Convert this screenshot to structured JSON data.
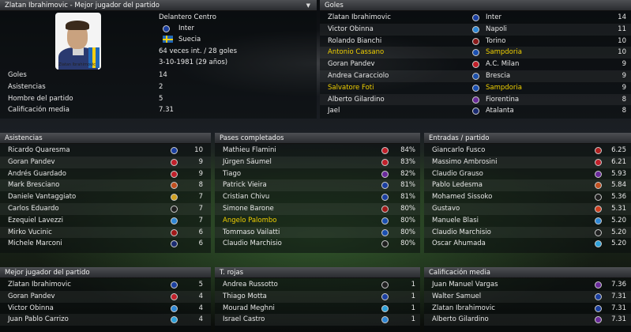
{
  "player_panel": {
    "title": "Zlatan Ibrahimovic - Mejor jugador del partido",
    "position": "Delantero Centro",
    "club": "Inter",
    "nation": "Suecia",
    "caps": "64 veces int. / 28 goles",
    "birth": "3-10-1981 (29 años)",
    "photo_caption": "Zlatan Ibrahimovic",
    "stats": [
      {
        "label": "Goles",
        "value": "14"
      },
      {
        "label": "Asistencias",
        "value": "2"
      },
      {
        "label": "Hombre del partido",
        "value": "5"
      },
      {
        "label": "Calificación media",
        "value": "7.31"
      }
    ]
  },
  "goles": {
    "title": "Goles",
    "rows": [
      {
        "name": "Zlatan Ibrahimovic",
        "club": "Inter",
        "value": "14",
        "badge": "#1b3fa0",
        "hl": false
      },
      {
        "name": "Victor Obinna",
        "club": "Napoli",
        "value": "11",
        "badge": "#2e86d4",
        "hl": false
      },
      {
        "name": "Rolando Bianchi",
        "club": "Torino",
        "value": "10",
        "badge": "#8b1a1a",
        "hl": false
      },
      {
        "name": "Antonio Cassano",
        "club": "Sampdoria",
        "value": "10",
        "badge": "#1a4fb0",
        "hl": true
      },
      {
        "name": "Goran Pandev",
        "club": "A.C. Milan",
        "value": "9",
        "badge": "#c0202a",
        "hl": false
      },
      {
        "name": "Andrea Caracciolo",
        "club": "Brescia",
        "value": "9",
        "badge": "#1c4fa8",
        "hl": false
      },
      {
        "name": "Salvatore Foti",
        "club": "Sampdoria",
        "value": "9",
        "badge": "#1a4fb0",
        "hl": true
      },
      {
        "name": "Alberto Gilardino",
        "club": "Fiorentina",
        "value": "8",
        "badge": "#6a2a9a",
        "hl": false
      },
      {
        "name": "Jael",
        "club": "Atalanta",
        "value": "8",
        "badge": "#1a2a70",
        "hl": false
      }
    ]
  },
  "asistencias": {
    "title": "Asistencias",
    "rows": [
      {
        "name": "Ricardo Quaresma",
        "value": "10",
        "badge": "#1b3fa0",
        "hl": false
      },
      {
        "name": "Goran Pandev",
        "value": "9",
        "badge": "#c0202a",
        "hl": false
      },
      {
        "name": "Andrés Guardado",
        "value": "9",
        "badge": "#c0202a",
        "hl": false
      },
      {
        "name": "Mark Bresciano",
        "value": "8",
        "badge": "#c05020",
        "hl": false
      },
      {
        "name": "Daniele Vantaggiato",
        "value": "7",
        "badge": "#d0a020",
        "hl": false
      },
      {
        "name": "Carlos Eduardo",
        "value": "7",
        "badge": "#202020",
        "hl": false
      },
      {
        "name": "Ezequiel Lavezzi",
        "value": "7",
        "badge": "#2e86d4",
        "hl": false
      },
      {
        "name": "Mirko Vucinic",
        "value": "6",
        "badge": "#a01818",
        "hl": false
      },
      {
        "name": "Michele Marconi",
        "value": "6",
        "badge": "#1a2a70",
        "hl": false
      }
    ]
  },
  "pases": {
    "title": "Pases completados",
    "rows": [
      {
        "name": "Mathieu Flamini",
        "value": "84%",
        "badge": "#c0202a",
        "hl": false
      },
      {
        "name": "Jürgen Säumel",
        "value": "83%",
        "badge": "#c0202a",
        "hl": false
      },
      {
        "name": "Tiago",
        "value": "82%",
        "badge": "#6a2a9a",
        "hl": false
      },
      {
        "name": "Patrick Vieira",
        "value": "81%",
        "badge": "#1b3fa0",
        "hl": false
      },
      {
        "name": "Cristian Chivu",
        "value": "81%",
        "badge": "#1b3fa0",
        "hl": false
      },
      {
        "name": "Simone Barone",
        "value": "80%",
        "badge": "#a01818",
        "hl": false
      },
      {
        "name": "Angelo Palombo",
        "value": "80%",
        "badge": "#1a4fb0",
        "hl": true
      },
      {
        "name": "Tommaso Vailatti",
        "value": "80%",
        "badge": "#1a4fb0",
        "hl": false
      },
      {
        "name": "Claudio Marchisio",
        "value": "80%",
        "badge": "#202020",
        "hl": false
      }
    ]
  },
  "entradas": {
    "title": "Entradas / partido",
    "rows": [
      {
        "name": "Giancarlo Fusco",
        "value": "6.25",
        "badge": "#b02020",
        "hl": false
      },
      {
        "name": "Massimo Ambrosini",
        "value": "6.21",
        "badge": "#c0202a",
        "hl": false
      },
      {
        "name": "Claudio Grauso",
        "value": "5.93",
        "badge": "#6a2a9a",
        "hl": false
      },
      {
        "name": "Pablo Ledesma",
        "value": "5.84",
        "badge": "#c05020",
        "hl": false
      },
      {
        "name": "Mohamed Sissoko",
        "value": "5.36",
        "badge": "#202020",
        "hl": false
      },
      {
        "name": "Gustavo",
        "value": "5.31",
        "badge": "#d04020",
        "hl": false
      },
      {
        "name": "Manuele Blasi",
        "value": "5.20",
        "badge": "#2e86d4",
        "hl": false
      },
      {
        "name": "Claudio Marchisio",
        "value": "5.20",
        "badge": "#202020",
        "hl": false
      },
      {
        "name": "Oscar Ahumada",
        "value": "5.20",
        "badge": "#2ea0d8",
        "hl": false
      }
    ]
  },
  "mejor": {
    "title": "Mejor jugador del partido",
    "rows": [
      {
        "name": "Zlatan Ibrahimovic",
        "value": "5",
        "badge": "#1b3fa0",
        "hl": false
      },
      {
        "name": "Goran Pandev",
        "value": "4",
        "badge": "#c0202a",
        "hl": false
      },
      {
        "name": "Victor Obinna",
        "value": "4",
        "badge": "#2e86d4",
        "hl": false
      },
      {
        "name": "Juan Pablo Carrizo",
        "value": "4",
        "badge": "#2ea0d8",
        "hl": false
      }
    ]
  },
  "rojas": {
    "title": "T. rojas",
    "rows": [
      {
        "name": "Andrea Russotto",
        "value": "1",
        "badge": "#202020",
        "hl": false
      },
      {
        "name": "Thiago Motta",
        "value": "1",
        "badge": "#1b3fa0",
        "hl": false
      },
      {
        "name": "Mourad Meghni",
        "value": "1",
        "badge": "#2ea0d8",
        "hl": false
      },
      {
        "name": "Israel Castro",
        "value": "1",
        "badge": "#2e86d4",
        "hl": false
      }
    ]
  },
  "calificacion": {
    "title": "Calificación media",
    "rows": [
      {
        "name": "Juan Manuel Vargas",
        "value": "7.36",
        "badge": "#6a2a9a",
        "hl": false
      },
      {
        "name": "Walter Samuel",
        "value": "7.31",
        "badge": "#1b3fa0",
        "hl": false
      },
      {
        "name": "Zlatan Ibrahimovic",
        "value": "7.31",
        "badge": "#1b3fa0",
        "hl": false
      },
      {
        "name": "Alberto Gilardino",
        "value": "7.31",
        "badge": "#6a2a9a",
        "hl": false
      }
    ]
  }
}
